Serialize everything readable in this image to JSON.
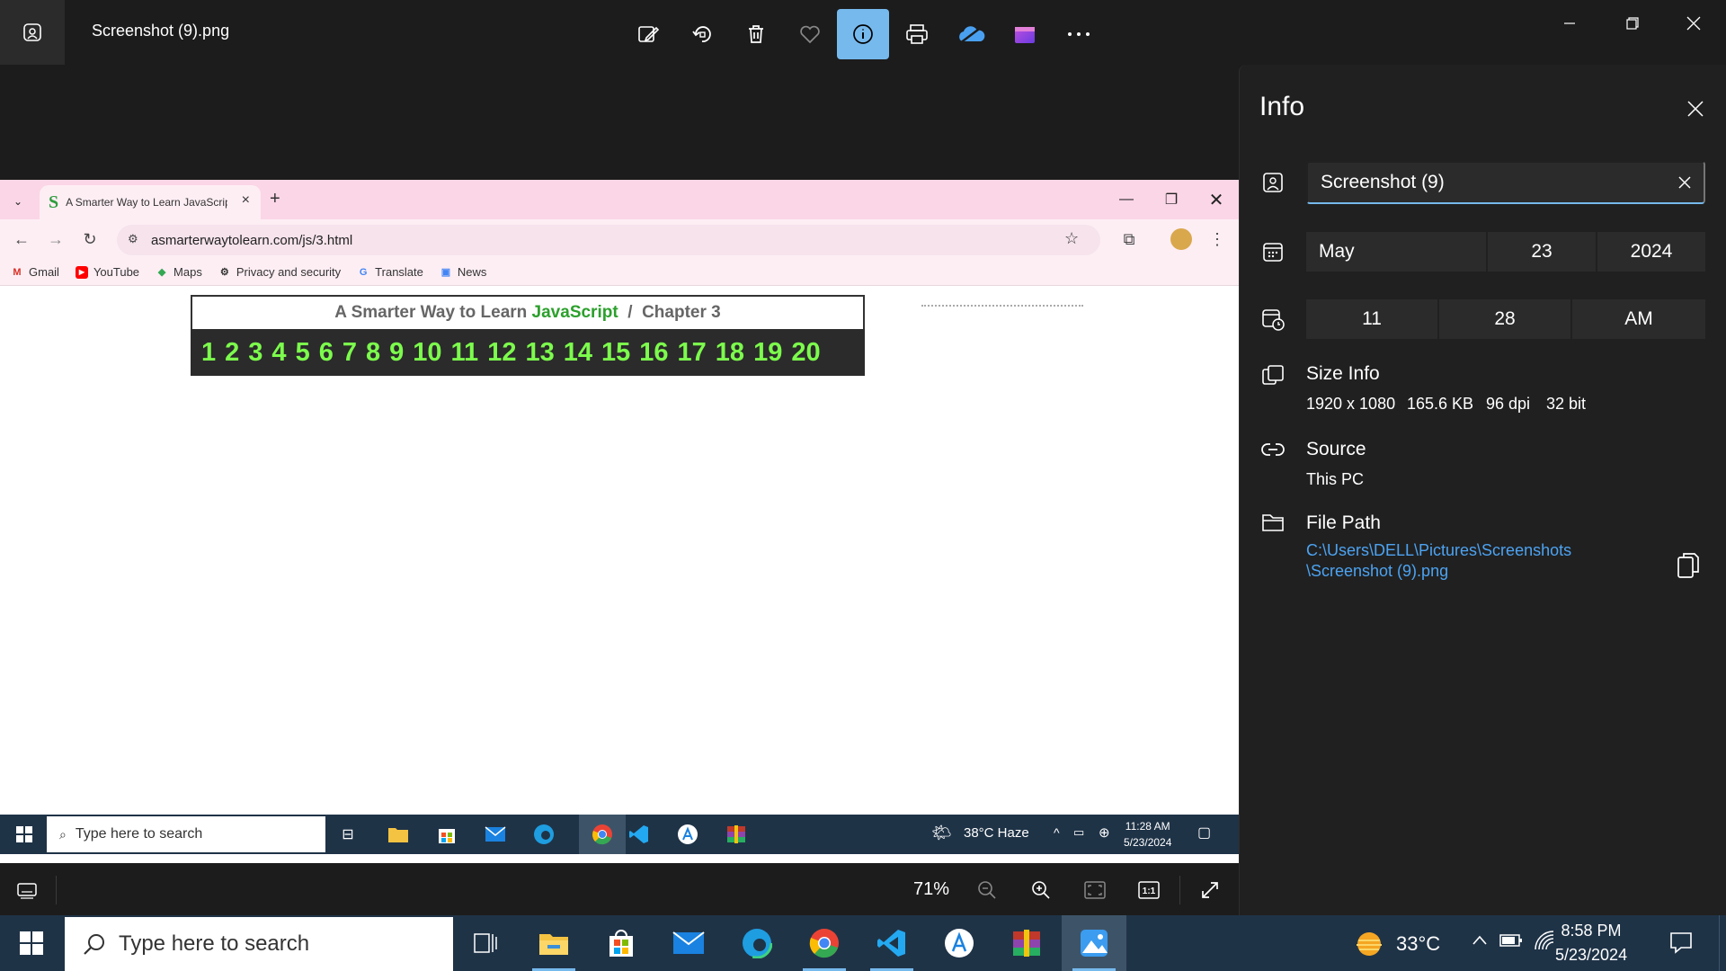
{
  "app": {
    "file_title": "Screenshot (9).png",
    "toolbar": [
      "edit-icon",
      "rotate-icon",
      "delete-icon",
      "favorite-icon",
      "info-icon",
      "print-icon",
      "onedrive-icon",
      "clipchamp-icon",
      "more-icon"
    ]
  },
  "screenshot": {
    "tab_label": "A Smarter Way to Learn JavaScript",
    "url": "asmarterwaytolearn.com/js/3.html",
    "bookmarks": [
      "Gmail",
      "YouTube",
      "Maps",
      "Privacy and security",
      "Translate",
      "News"
    ],
    "chapter_title_prefix": "A Smarter Way to Learn ",
    "chapter_title_js": "JavaScript",
    "chapter_title_suffix": "  /  Chapter 3",
    "chapter_numbers": [
      "1",
      "2",
      "3",
      "4",
      "5",
      "6",
      "7",
      "8",
      "9",
      "10",
      "11",
      "12",
      "13",
      "14",
      "15",
      "16",
      "17",
      "18",
      "19",
      "20"
    ],
    "taskbar_search": "Type here to search",
    "weather": "38°C  Haze",
    "time": "11:28 AM",
    "date": "5/23/2024"
  },
  "zoom": {
    "level": "71%"
  },
  "info": {
    "title": "Info",
    "file_name": "Screenshot (9)",
    "date_month": "May",
    "date_day": "23",
    "date_year": "2024",
    "time_hour": "11",
    "time_minute": "28",
    "time_ampm": "AM",
    "size_label": "Size Info",
    "size_dims": "1920 x 1080",
    "size_kb": "165.6 KB",
    "size_dpi": "96 dpi",
    "size_bit": "32 bit",
    "source_label": "Source",
    "source_value": "This PC",
    "path_label": "File Path",
    "path_line1": "C:\\Users\\DELL\\Pictures\\Screenshots",
    "path_line2": "\\Screenshot (9).png"
  },
  "taskbar": {
    "search_placeholder": "Type here to search",
    "weather": "33°C",
    "time": "8:58 PM",
    "date": "5/23/2024"
  },
  "colors": {
    "accent": "#76b9ed",
    "link": "#4ca3f2",
    "js_green": "#2ca02c",
    "number_green": "#7cfc4c"
  }
}
